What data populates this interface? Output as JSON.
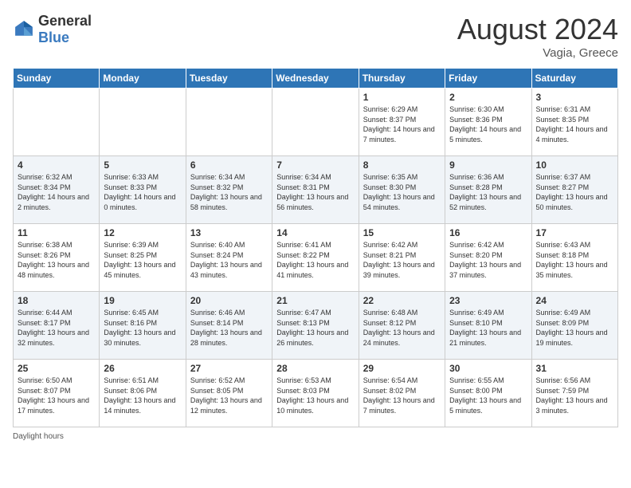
{
  "header": {
    "logo_general": "General",
    "logo_blue": "Blue",
    "month_year": "August 2024",
    "location": "Vagia, Greece"
  },
  "weekdays": [
    "Sunday",
    "Monday",
    "Tuesday",
    "Wednesday",
    "Thursday",
    "Friday",
    "Saturday"
  ],
  "weeks": [
    [
      {
        "day": "",
        "info": ""
      },
      {
        "day": "",
        "info": ""
      },
      {
        "day": "",
        "info": ""
      },
      {
        "day": "",
        "info": ""
      },
      {
        "day": "1",
        "info": "Sunrise: 6:29 AM\nSunset: 8:37 PM\nDaylight: 14 hours and 7 minutes."
      },
      {
        "day": "2",
        "info": "Sunrise: 6:30 AM\nSunset: 8:36 PM\nDaylight: 14 hours and 5 minutes."
      },
      {
        "day": "3",
        "info": "Sunrise: 6:31 AM\nSunset: 8:35 PM\nDaylight: 14 hours and 4 minutes."
      }
    ],
    [
      {
        "day": "4",
        "info": "Sunrise: 6:32 AM\nSunset: 8:34 PM\nDaylight: 14 hours and 2 minutes."
      },
      {
        "day": "5",
        "info": "Sunrise: 6:33 AM\nSunset: 8:33 PM\nDaylight: 14 hours and 0 minutes."
      },
      {
        "day": "6",
        "info": "Sunrise: 6:34 AM\nSunset: 8:32 PM\nDaylight: 13 hours and 58 minutes."
      },
      {
        "day": "7",
        "info": "Sunrise: 6:34 AM\nSunset: 8:31 PM\nDaylight: 13 hours and 56 minutes."
      },
      {
        "day": "8",
        "info": "Sunrise: 6:35 AM\nSunset: 8:30 PM\nDaylight: 13 hours and 54 minutes."
      },
      {
        "day": "9",
        "info": "Sunrise: 6:36 AM\nSunset: 8:28 PM\nDaylight: 13 hours and 52 minutes."
      },
      {
        "day": "10",
        "info": "Sunrise: 6:37 AM\nSunset: 8:27 PM\nDaylight: 13 hours and 50 minutes."
      }
    ],
    [
      {
        "day": "11",
        "info": "Sunrise: 6:38 AM\nSunset: 8:26 PM\nDaylight: 13 hours and 48 minutes."
      },
      {
        "day": "12",
        "info": "Sunrise: 6:39 AM\nSunset: 8:25 PM\nDaylight: 13 hours and 45 minutes."
      },
      {
        "day": "13",
        "info": "Sunrise: 6:40 AM\nSunset: 8:24 PM\nDaylight: 13 hours and 43 minutes."
      },
      {
        "day": "14",
        "info": "Sunrise: 6:41 AM\nSunset: 8:22 PM\nDaylight: 13 hours and 41 minutes."
      },
      {
        "day": "15",
        "info": "Sunrise: 6:42 AM\nSunset: 8:21 PM\nDaylight: 13 hours and 39 minutes."
      },
      {
        "day": "16",
        "info": "Sunrise: 6:42 AM\nSunset: 8:20 PM\nDaylight: 13 hours and 37 minutes."
      },
      {
        "day": "17",
        "info": "Sunrise: 6:43 AM\nSunset: 8:18 PM\nDaylight: 13 hours and 35 minutes."
      }
    ],
    [
      {
        "day": "18",
        "info": "Sunrise: 6:44 AM\nSunset: 8:17 PM\nDaylight: 13 hours and 32 minutes."
      },
      {
        "day": "19",
        "info": "Sunrise: 6:45 AM\nSunset: 8:16 PM\nDaylight: 13 hours and 30 minutes."
      },
      {
        "day": "20",
        "info": "Sunrise: 6:46 AM\nSunset: 8:14 PM\nDaylight: 13 hours and 28 minutes."
      },
      {
        "day": "21",
        "info": "Sunrise: 6:47 AM\nSunset: 8:13 PM\nDaylight: 13 hours and 26 minutes."
      },
      {
        "day": "22",
        "info": "Sunrise: 6:48 AM\nSunset: 8:12 PM\nDaylight: 13 hours and 24 minutes."
      },
      {
        "day": "23",
        "info": "Sunrise: 6:49 AM\nSunset: 8:10 PM\nDaylight: 13 hours and 21 minutes."
      },
      {
        "day": "24",
        "info": "Sunrise: 6:49 AM\nSunset: 8:09 PM\nDaylight: 13 hours and 19 minutes."
      }
    ],
    [
      {
        "day": "25",
        "info": "Sunrise: 6:50 AM\nSunset: 8:07 PM\nDaylight: 13 hours and 17 minutes."
      },
      {
        "day": "26",
        "info": "Sunrise: 6:51 AM\nSunset: 8:06 PM\nDaylight: 13 hours and 14 minutes."
      },
      {
        "day": "27",
        "info": "Sunrise: 6:52 AM\nSunset: 8:05 PM\nDaylight: 13 hours and 12 minutes."
      },
      {
        "day": "28",
        "info": "Sunrise: 6:53 AM\nSunset: 8:03 PM\nDaylight: 13 hours and 10 minutes."
      },
      {
        "day": "29",
        "info": "Sunrise: 6:54 AM\nSunset: 8:02 PM\nDaylight: 13 hours and 7 minutes."
      },
      {
        "day": "30",
        "info": "Sunrise: 6:55 AM\nSunset: 8:00 PM\nDaylight: 13 hours and 5 minutes."
      },
      {
        "day": "31",
        "info": "Sunrise: 6:56 AM\nSunset: 7:59 PM\nDaylight: 13 hours and 3 minutes."
      }
    ]
  ],
  "footer": "Daylight hours"
}
